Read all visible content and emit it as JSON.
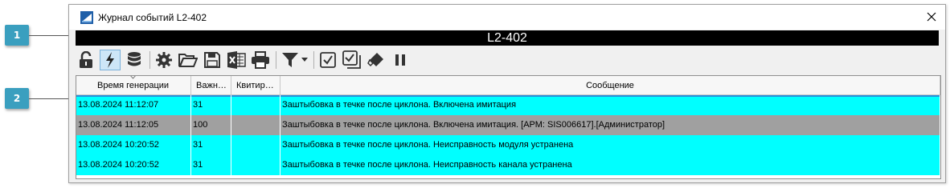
{
  "callouts": [
    "1",
    "2"
  ],
  "window": {
    "title": "Журнал событий L2-402",
    "banner": "L2-402"
  },
  "toolbar": {
    "buttons": [
      {
        "icon": "unlock-icon",
        "active": false
      },
      {
        "icon": "lightning-icon",
        "active": true
      },
      {
        "icon": "database-icon",
        "active": false
      },
      {
        "icon": "gear-icon",
        "active": false
      },
      {
        "icon": "folder-open-icon",
        "active": false
      },
      {
        "icon": "save-icon",
        "active": false
      },
      {
        "icon": "excel-icon",
        "active": false
      },
      {
        "icon": "print-icon",
        "active": false
      },
      {
        "icon": "filter-icon",
        "active": false
      },
      {
        "icon": "acknowledge-icon",
        "active": false
      },
      {
        "icon": "acknowledge-all-icon",
        "active": false
      },
      {
        "icon": "eraser-icon",
        "active": false
      },
      {
        "icon": "pause-icon",
        "active": false
      }
    ]
  },
  "table": {
    "columns": [
      "Время генерации",
      "Важн…",
      "Квитир…",
      "Сообщение"
    ],
    "rows": [
      {
        "time": "13.08.2024 11:12:07",
        "severity": "31",
        "ack": "",
        "message": "Заштыбовка в течке после циклона. Включена имитация",
        "bg": "#00ffff"
      },
      {
        "time": "13.08.2024 11:12:05",
        "severity": "100",
        "ack": "",
        "message": "Заштыбовка в течке после циклона. Включена имитация. [АРМ: SIS006617].[Администратор]",
        "bg": "#a0a0a0"
      },
      {
        "time": "13.08.2024 10:20:52",
        "severity": "31",
        "ack": "",
        "message": "Заштыбовка в течке после циклона. Неисправность модуля устранена",
        "bg": "#00ffff"
      },
      {
        "time": "13.08.2024 10:20:52",
        "severity": "31",
        "ack": "",
        "message": "Заштыбовка в течке после циклона. Неисправность канала устранена",
        "bg": "#00ffff"
      }
    ]
  },
  "colors": {
    "accent": "#3a9fbf",
    "selection": "#2a8fd8"
  }
}
